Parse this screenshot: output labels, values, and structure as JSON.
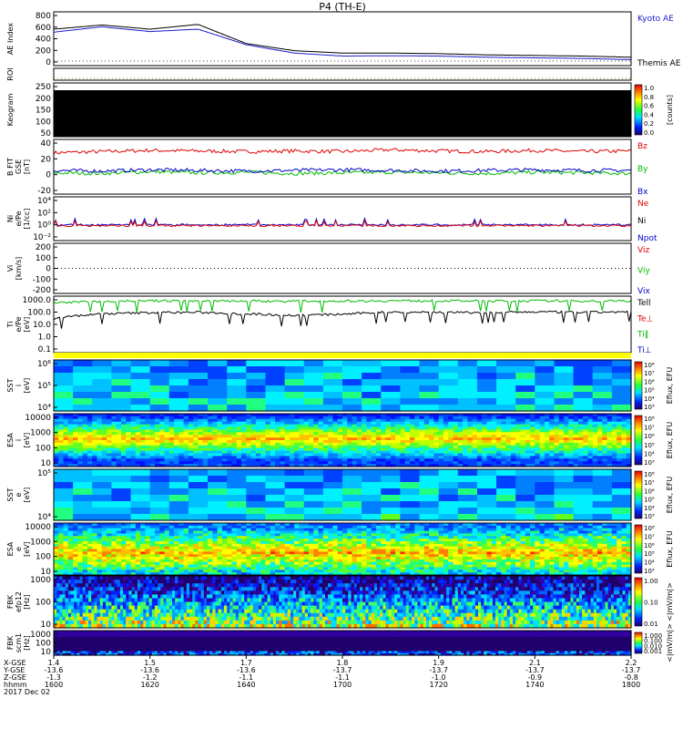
{
  "title": "P4 (TH-E)",
  "date_label": "2017 Dec 02",
  "panels": [
    {
      "id": "ae",
      "ylabel": [
        "AE Index"
      ],
      "ticks": [
        "800",
        "600",
        "400",
        "200",
        "0"
      ],
      "legend": [
        {
          "text": "Kyoto AE",
          "color": "#1a1acc"
        },
        {
          "text": "Themis AE",
          "color": "#000000"
        }
      ]
    },
    {
      "id": "roi",
      "ylabel": [
        "ROI"
      ],
      "ticks": [],
      "legend": []
    },
    {
      "id": "keogram",
      "ylabel": [
        "Keogram"
      ],
      "ticks": [
        "250",
        "200",
        "150",
        "100",
        "50"
      ],
      "legend": [],
      "colorbar": {
        "label": "[counts]",
        "ticks": [
          "1.0",
          "0.8",
          "0.6",
          "0.4",
          "0.2",
          "0.0"
        ]
      }
    },
    {
      "id": "bfield",
      "ylabel": [
        "B FIT",
        "GSE",
        "[nT]"
      ],
      "ticks": [
        "40",
        "20",
        "0",
        "-20"
      ],
      "legend": [
        {
          "text": "Bz",
          "color": "#e00000"
        },
        {
          "text": "By",
          "color": "#00bb00"
        },
        {
          "text": "Bx",
          "color": "#0000cc"
        }
      ]
    },
    {
      "id": "density",
      "ylabel": [
        "Ni",
        "e/Pe",
        "[1/cc]"
      ],
      "ticks": [
        "10⁴",
        "10²",
        "10⁰",
        "10⁻²"
      ],
      "legend": [
        {
          "text": "Ne",
          "color": "#e00000"
        },
        {
          "text": "Ni",
          "color": "#000000"
        },
        {
          "text": "Npot",
          "color": "#0000cc"
        }
      ]
    },
    {
      "id": "velocity",
      "ylabel": [
        "Vi",
        "[km/s]"
      ],
      "ticks": [
        "200",
        "100",
        "0",
        "-100",
        "-200"
      ],
      "legend": [
        {
          "text": "Viz",
          "color": "#e00000"
        },
        {
          "text": "Viy",
          "color": "#00bb00"
        },
        {
          "text": "Vix",
          "color": "#0000cc"
        }
      ]
    },
    {
      "id": "temp",
      "ylabel": [
        "Ti",
        "e/Pe",
        "[eV]"
      ],
      "ticks": [
        "1000.0",
        "100.0",
        "10.0",
        "1.0",
        "0.1"
      ],
      "legend": [
        {
          "text": "Tell",
          "color": "#000000"
        },
        {
          "text": "Te⊥",
          "color": "#e00000"
        },
        {
          "text": "Ti‖",
          "color": "#00bb00"
        },
        {
          "text": "Ti⊥",
          "color": "#0000cc"
        }
      ]
    },
    {
      "id": "sst_i",
      "ylabel": [
        "SST",
        "i",
        "[eV]"
      ],
      "ticks": [
        "10⁶",
        "10⁵",
        "10⁴"
      ],
      "legend": [],
      "colorbar": {
        "label": "Eflux, EFU",
        "ticks": [
          "10⁸",
          "10⁷",
          "10⁶",
          "10⁵",
          "10⁴",
          "10³"
        ]
      }
    },
    {
      "id": "esa_i",
      "ylabel": [
        "ESA",
        "i",
        "[eV]"
      ],
      "ticks": [
        "10000",
        "1000",
        "100",
        "10"
      ],
      "legend": [],
      "colorbar": {
        "label": "Eflux, EFU",
        "ticks": [
          "10⁸",
          "10⁷",
          "10⁶",
          "10⁵",
          "10⁴",
          "10³"
        ]
      }
    },
    {
      "id": "sst_e",
      "ylabel": [
        "SST",
        "e",
        "[eV]"
      ],
      "ticks": [
        "10⁵",
        "10⁴"
      ],
      "legend": [],
      "colorbar": {
        "label": "Eflux, EFU",
        "ticks": [
          "10⁸",
          "10⁷",
          "10⁶",
          "10⁵",
          "10⁴",
          "10³"
        ]
      }
    },
    {
      "id": "esa_e",
      "ylabel": [
        "ESA",
        "e",
        "[eV]"
      ],
      "ticks": [
        "10000",
        "1000",
        "100",
        "10"
      ],
      "legend": [],
      "colorbar": {
        "label": "Eflux, EFU",
        "ticks": [
          "10⁸",
          "10⁷",
          "10⁶",
          "10⁵",
          "10⁴",
          "10³"
        ]
      }
    },
    {
      "id": "fbk_e",
      "ylabel": [
        "FBK",
        "efp12",
        "[Hz]"
      ],
      "ticks": [
        "1000",
        "100",
        "10"
      ],
      "legend": [],
      "colorbar": {
        "label": "<|mV/m|>",
        "ticks": [
          "1.00",
          "0.10",
          "0.01"
        ]
      }
    },
    {
      "id": "fbk_b",
      "ylabel": [
        "FBK",
        "scm1",
        "[Hz]"
      ],
      "ticks": [
        "1000",
        "100",
        "10"
      ],
      "legend": [],
      "colorbar": {
        "label": "<|mV/m|>",
        "ticks": [
          "1.000",
          "0.100",
          "0.010",
          "0.001"
        ]
      }
    }
  ],
  "xaxis": {
    "row_labels": [
      "X-GSE",
      "Y-GSE",
      "Z-GSE",
      "hhmm"
    ],
    "columns": [
      {
        "x": "1.4",
        "y": "-13.6",
        "z": "-1.3",
        "t": "1600"
      },
      {
        "x": "1.5",
        "y": "-13.6",
        "z": "-1.2",
        "t": "1620"
      },
      {
        "x": "1.7",
        "y": "-13.6",
        "z": "-1.1",
        "t": "1640"
      },
      {
        "x": "1.8",
        "y": "-13.7",
        "z": "-1.1",
        "t": "1700"
      },
      {
        "x": "1.9",
        "y": "-13.7",
        "z": "-1.0",
        "t": "1720"
      },
      {
        "x": "2.1",
        "y": "-13.7",
        "z": "-0.9",
        "t": "1740"
      },
      {
        "x": "2.2",
        "y": "-13.7",
        "z": "-0.8",
        "t": "1800"
      }
    ]
  },
  "chart_data": [
    {
      "type": "line",
      "panel": "ae",
      "ylim": [
        -50,
        850
      ],
      "x": [
        "16:00",
        "16:10",
        "16:20",
        "16:30",
        "16:40",
        "16:50",
        "17:00",
        "17:10",
        "17:20",
        "17:30",
        "17:40",
        "17:50",
        "18:00"
      ],
      "series": [
        {
          "name": "Kyoto AE",
          "values": [
            510,
            600,
            520,
            560,
            300,
            160,
            110,
            115,
            110,
            90,
            80,
            70,
            50
          ]
        },
        {
          "name": "Themis AE",
          "values": [
            560,
            630,
            560,
            640,
            320,
            200,
            160,
            160,
            150,
            130,
            120,
            110,
            90
          ]
        }
      ]
    },
    {
      "type": "line",
      "panel": "bfield",
      "ylim": [
        -40,
        50
      ],
      "series": [
        {
          "name": "Bz",
          "values": [
            28,
            30,
            32,
            31,
            30,
            31,
            30,
            33,
            31,
            30,
            32,
            30,
            31
          ]
        },
        {
          "name": "By",
          "values": [
            -5,
            -6,
            -3,
            -5,
            -4,
            -6,
            -5,
            -4,
            -5,
            -6,
            -4,
            -5,
            -6
          ]
        },
        {
          "name": "Bx",
          "values": [
            -1,
            -2,
            0,
            -1,
            -2,
            -1,
            0,
            -1,
            -2,
            -1,
            0,
            -1,
            -1
          ]
        }
      ]
    },
    {
      "type": "line",
      "panel": "temp",
      "ylim": [
        0.1,
        3000
      ],
      "series": [
        {
          "name": "Tell",
          "values": [
            50,
            120,
            150,
            160,
            120,
            90,
            110,
            170,
            160,
            150,
            170,
            160,
            170
          ]
        },
        {
          "name": "Ti‖",
          "values": [
            900,
            1200,
            1300,
            1300,
            1250,
            1200,
            1250,
            1300,
            1300,
            1250,
            1300,
            1250,
            1300
          ]
        }
      ]
    }
  ]
}
